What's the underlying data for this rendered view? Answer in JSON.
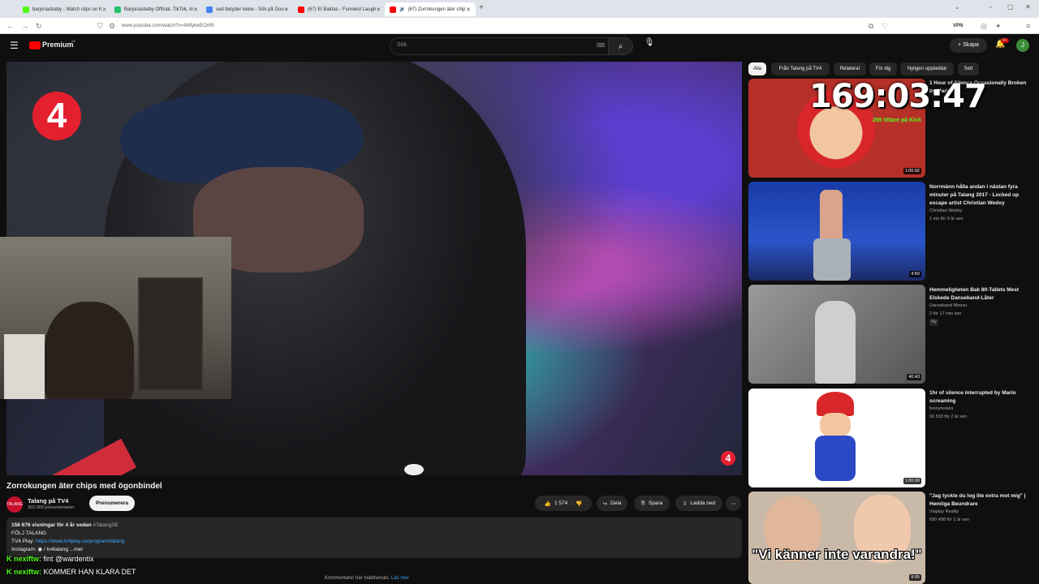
{
  "browser": {
    "tabs": [
      {
        "label": "barjonasbaby - Watch clips on K",
        "color": "#53fc18"
      },
      {
        "label": "Barjonasbaby Official, TikTok, In",
        "color": "#25c36b"
      },
      {
        "label": "vad betyder kekw - Sök på Goo",
        "color": "#4285f4"
      },
      {
        "label": "(67) El Baktas - Funniest Laugh",
        "color": "#ff0000"
      },
      {
        "label": "(67) Zorrokungen äter chip",
        "color": "#ff0000"
      }
    ],
    "url": "www.youtube.com/watch?v=4MfykwEOnRi",
    "vpn_label": "VPN"
  },
  "header": {
    "logo": "Premium",
    "region": "SE",
    "search_placeholder": "Sök",
    "create_label": "Skapa",
    "notifications": "9+",
    "avatar_letter": "J"
  },
  "video": {
    "title": "Zorrokungen äter chips med ögonbindel",
    "logo_text": "4",
    "channel": "Talang på TV4",
    "channel_avatar": "TALANG",
    "subscribers": "303 000 prenumeranter",
    "subscribe_label": "Prenumerera",
    "likes": "1 574",
    "share_label": "Dela",
    "save_label": "Spara",
    "download_label": "Ladda ned",
    "description": {
      "stats": "156 676 visningar  för 4 år sedan",
      "hashtag": "#TalangSE",
      "line1": "FÖLJ TALANG",
      "line2_prefix": "TV4 Play: ",
      "line2_link": "https://www.tv4play.se/program/talang",
      "line3_prefix": "Instagram: ",
      "line3_value": "/ tv4talang",
      "more": "...mer"
    },
    "comments_disabled": "Kommentarer har inaktiverats.",
    "comments_more": "Läs mer"
  },
  "chat": [
    {
      "user": "nexiftw",
      "message": "fint @wardentix"
    },
    {
      "user": "nexiftw",
      "message": "KOMMER HAN KLARA DET"
    }
  ],
  "overlay": {
    "timer": "169:03:47",
    "viewers": "265 tittare på Kick"
  },
  "chips": [
    "Alla",
    "Från Talang på TV4",
    "Relaterat",
    "För dig",
    "Nyligen uppladdat",
    "Sett"
  ],
  "recommendations": [
    {
      "title": "1 Hour of Silence Occasionally Broken by Mario ...",
      "channel": "",
      "meta": "",
      "duration": "1:00:02",
      "thumb_color": "#b63028"
    },
    {
      "title": "Norrmänn hålla andan i nästan fyra minuter på Talang 2017 - Locked up escape artist Christian Wedoy",
      "channel": "Christian Wedoy",
      "meta": "1 mn   för 9 år sen",
      "duration": "4:50",
      "thumb_color": "#2b4fa8"
    },
    {
      "title": "Hemmeligheten Bak 80-Tallets Mest Elskede Danseband-Låter",
      "channel": "Danseband Minner",
      "meta": "2   för 17 min sen",
      "badge": "Ny",
      "duration": "40:43",
      "thumb_color": "#808080"
    },
    {
      "title": "1hr of silence interrupted by Mario screaming",
      "channel": "funnynoises",
      "meta": "93 503   för 2 år sen",
      "duration": "1:00:00",
      "thumb_color": "#ffffff"
    },
    {
      "title": "\"Jag tyckte du log lite extra mot mig\" | Hemliga Beundrare",
      "channel": "Viaplay Reality",
      "meta": "690 498   för 2 år sen",
      "duration": "9:05",
      "thumb_caption": "\"Vi känner inte varandra!\"",
      "thumb_color": "#c9b9a8"
    }
  ]
}
